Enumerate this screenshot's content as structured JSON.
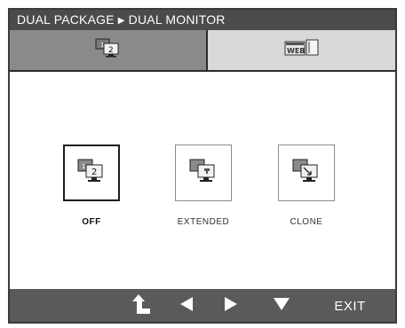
{
  "title": {
    "section": "DUAL PACKAGE",
    "separator": "▶",
    "page": "DUAL MONITOR"
  },
  "tabs": [
    {
      "icon": "dual-monitor-icon",
      "active": true
    },
    {
      "icon": "dual-web-icon",
      "active": false
    }
  ],
  "options": [
    {
      "label": "OFF",
      "icon": "dual-monitor-off-icon",
      "selected": true
    },
    {
      "label": "EXTENDED",
      "icon": "dual-monitor-extended-icon",
      "selected": false
    },
    {
      "label": "CLONE",
      "icon": "dual-monitor-clone-icon",
      "selected": false
    }
  ],
  "footer": {
    "buttons": [
      {
        "icon": "return-icon",
        "glyph": "⮤"
      },
      {
        "icon": "left-arrow-icon",
        "glyph": "◀"
      },
      {
        "icon": "right-arrow-icon",
        "glyph": "▶"
      },
      {
        "icon": "down-arrow-icon",
        "glyph": "▼"
      }
    ],
    "exit_label": "EXIT"
  },
  "colors": {
    "title_bg": "#4b4b4b",
    "active_tab": "#8a8a8a",
    "inactive_tab": "#d9d9d9",
    "footer_bg": "#5a5a5a"
  }
}
